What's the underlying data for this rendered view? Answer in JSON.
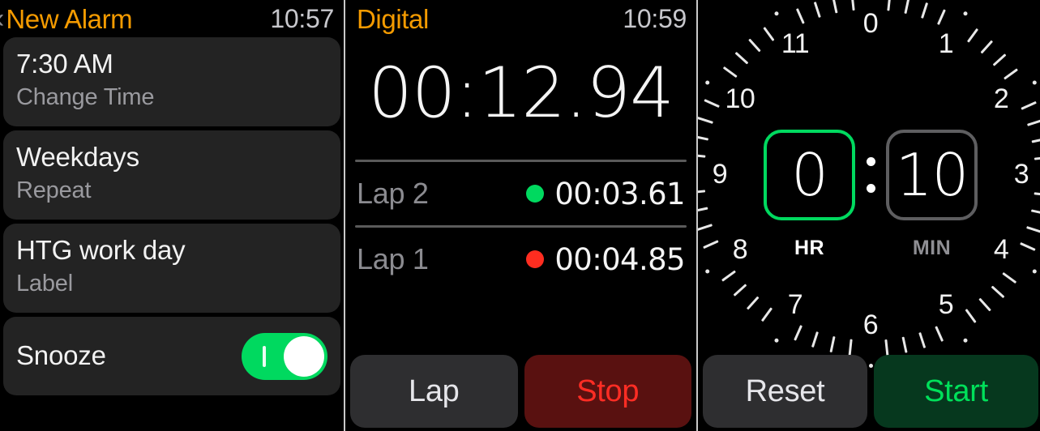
{
  "panels": {
    "alarm": {
      "header": {
        "back_icon": "chevron-left-icon",
        "title": "New Alarm",
        "clock": "10:57"
      },
      "rows": [
        {
          "primary": "7:30 AM",
          "secondary": "Change Time"
        },
        {
          "primary": "Weekdays",
          "secondary": "Repeat"
        },
        {
          "primary": "HTG work day",
          "secondary": "Label"
        }
      ],
      "toggle_row": {
        "label": "Snooze",
        "state": "on",
        "on_color": "#00d95f",
        "knob_color": "#ffffff"
      }
    },
    "stopwatch": {
      "header": {
        "title": "Digital",
        "clock": "10:59"
      },
      "elapsed": "00:12.94",
      "laps": [
        {
          "name": "Lap 2",
          "value": "00:03.61",
          "dot_color": "#00d95f"
        },
        {
          "name": "Lap 1",
          "value": "00:04.85",
          "dot_color": "#ff2d20"
        }
      ],
      "buttons": [
        {
          "label": "Lap",
          "style": "grey"
        },
        {
          "label": "Stop",
          "style": "stop"
        }
      ]
    },
    "timer": {
      "dial_numerals": [
        "0",
        "1",
        "2",
        "3",
        "4",
        "5",
        "6",
        "7",
        "8",
        "9",
        "10",
        "11"
      ],
      "fields": [
        {
          "value": "0",
          "label": "HR",
          "selected": true,
          "border_color": "#00d95f"
        },
        {
          "value": "10",
          "label": "MIN",
          "selected": false,
          "border_color": "#5e5e60"
        }
      ],
      "separator": ":",
      "buttons": [
        {
          "label": "Reset",
          "style": "grey"
        },
        {
          "label": "Start",
          "style": "start"
        }
      ]
    }
  }
}
